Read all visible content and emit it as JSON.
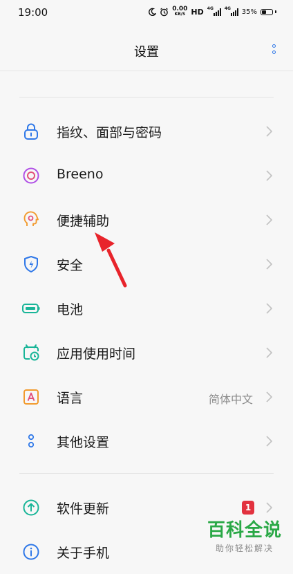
{
  "status_bar": {
    "time": "19:00",
    "speed_value": "0.00",
    "speed_unit": "KB/S",
    "hd": "HD",
    "signal1": "4G",
    "signal2": "4G",
    "battery": "35%"
  },
  "header": {
    "title": "设置"
  },
  "menu": [
    {
      "label": "指纹、面部与密码",
      "icon": "lock-icon"
    },
    {
      "label": "Breeno",
      "icon": "breeno-icon"
    },
    {
      "label": "便捷辅助",
      "icon": "assist-head-icon"
    },
    {
      "label": "安全",
      "icon": "shield-icon"
    },
    {
      "label": "电池",
      "icon": "battery-icon"
    },
    {
      "label": "应用使用时间",
      "icon": "app-timer-icon"
    },
    {
      "label": "语言",
      "value": "简体中文",
      "icon": "language-icon"
    },
    {
      "label": "其他设置",
      "icon": "other-settings-icon"
    },
    {
      "label": "软件更新",
      "badge": "1",
      "icon": "update-icon"
    },
    {
      "label": "关于手机",
      "icon": "info-icon"
    }
  ],
  "colors": {
    "accent_blue": "#2f78e8",
    "purple": "#b04fe6",
    "orange": "#f29a2e",
    "teal": "#19b598",
    "badge_red": "#e2323f",
    "watermark_green": "#2aa846"
  },
  "watermark": {
    "title": "百科全说",
    "subtitle": "助你轻松解决"
  }
}
